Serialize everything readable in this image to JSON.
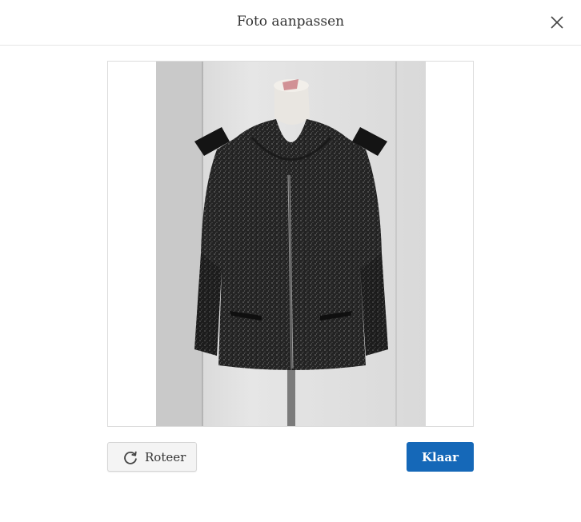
{
  "dialog": {
    "title": "Foto aanpassen",
    "close_icon": "close-icon"
  },
  "photo": {
    "subject": "zwarte tweed jas op paspop"
  },
  "actions": {
    "rotate_label": "Roteer",
    "rotate_icon": "rotate-icon",
    "done_label": "Klaar"
  },
  "colors": {
    "primary": "#1568b8",
    "secondary_bg": "#f4f4f4"
  }
}
